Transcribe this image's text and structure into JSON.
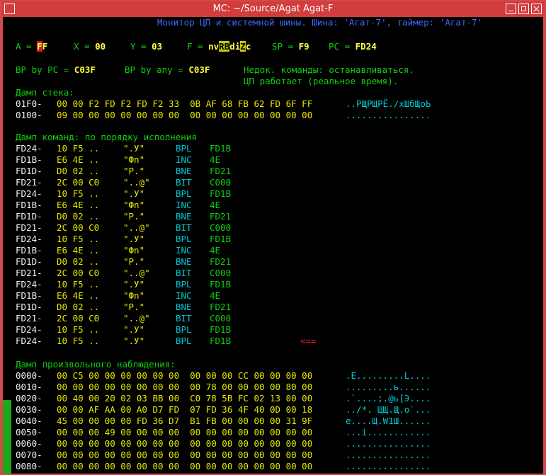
{
  "window": {
    "title": "MC: ~/Source/Agat Agat-F"
  },
  "header": "Монитор ЦП и системной шины. Шина: 'Агат-7', таймер: 'Агат-7'",
  "registers": {
    "a_label": "A = ",
    "a_value": "FF",
    "x_label": "X = ",
    "x_value": "00",
    "y_label": "Y = ",
    "y_value": "03",
    "f_label": "F = ",
    "f_value": "nvRBdiZc",
    "sp_label": "SP = ",
    "sp_value": "F9",
    "pc_label": "PC = ",
    "pc_value": "FD24"
  },
  "breakpoints": {
    "bp_pc_label": "BP by PC = ",
    "bp_pc_value": "C03F",
    "bp_any_label": "BP by any = ",
    "bp_any_value": "C03F",
    "status1": "Недок. команды: останавливаться.",
    "status2": "ЦП работает (реальное время)."
  },
  "stack": {
    "title": "Дамп стека:",
    "rows": [
      {
        "addr": "01F0-",
        "hex": "00 00 F2 FD F2 FD F2 33  0B AF 68 FB 62 FD 6F FF",
        "ascii": "..РЩРЩРЁ./хШбЩоЬ"
      },
      {
        "addr": "0100-",
        "hex": "09 00 00 00 00 00 00 00  00 00 00 00 00 00 00 00",
        "ascii": "................"
      }
    ]
  },
  "disasm": {
    "title": "Дамп команд: по порядку исполнения",
    "arrow": "<==",
    "rows": [
      {
        "addr": "FD24-",
        "bytes": "10 F5 ..",
        "chars": "\".У\"",
        "op": "BPL",
        "arg": "FD1B"
      },
      {
        "addr": "FD1B-",
        "bytes": "E6 4E ..",
        "chars": "\"Фn\"",
        "op": "INC",
        "arg": "4E"
      },
      {
        "addr": "FD1D-",
        "bytes": "D0 02 ..",
        "chars": "\"Р.\"",
        "op": "BNE",
        "arg": "FD21"
      },
      {
        "addr": "FD21-",
        "bytes": "2C 00 C0",
        "chars": "\"..@\"",
        "op": "BIT",
        "arg": "C000"
      },
      {
        "addr": "FD24-",
        "bytes": "10 F5 ..",
        "chars": "\".У\"",
        "op": "BPL",
        "arg": "FD1B"
      },
      {
        "addr": "FD1B-",
        "bytes": "E6 4E ..",
        "chars": "\"Фn\"",
        "op": "INC",
        "arg": "4E"
      },
      {
        "addr": "FD1D-",
        "bytes": "D0 02 ..",
        "chars": "\"Р.\"",
        "op": "BNE",
        "arg": "FD21"
      },
      {
        "addr": "FD21-",
        "bytes": "2C 00 C0",
        "chars": "\"..@\"",
        "op": "BIT",
        "arg": "C000"
      },
      {
        "addr": "FD24-",
        "bytes": "10 F5 ..",
        "chars": "\".У\"",
        "op": "BPL",
        "arg": "FD1B"
      },
      {
        "addr": "FD1B-",
        "bytes": "E6 4E ..",
        "chars": "\"Фn\"",
        "op": "INC",
        "arg": "4E"
      },
      {
        "addr": "FD1D-",
        "bytes": "D0 02 ..",
        "chars": "\"Р.\"",
        "op": "BNE",
        "arg": "FD21"
      },
      {
        "addr": "FD21-",
        "bytes": "2C 00 C0",
        "chars": "\"..@\"",
        "op": "BIT",
        "arg": "C000"
      },
      {
        "addr": "FD24-",
        "bytes": "10 F5 ..",
        "chars": "\".У\"",
        "op": "BPL",
        "arg": "FD1B"
      },
      {
        "addr": "FD1B-",
        "bytes": "E6 4E ..",
        "chars": "\"Фn\"",
        "op": "INC",
        "arg": "4E"
      },
      {
        "addr": "FD1D-",
        "bytes": "D0 02 ..",
        "chars": "\"Р.\"",
        "op": "BNE",
        "arg": "FD21"
      },
      {
        "addr": "FD21-",
        "bytes": "2C 00 C0",
        "chars": "\"..@\"",
        "op": "BIT",
        "arg": "C000"
      },
      {
        "addr": "FD24-",
        "bytes": "10 F5 ..",
        "chars": "\".У\"",
        "op": "BPL",
        "arg": "FD1B"
      },
      {
        "addr": "FD24-",
        "bytes": "10 F5 ..",
        "chars": "\".У\"",
        "op": "BPL",
        "arg": "FD1B"
      }
    ]
  },
  "watch": {
    "title": "Дамп произвольного наблюдения:",
    "rows": [
      {
        "addr": "0000-",
        "hex": "00 C5 00 00 00 00 00 00  00 00 00 CC 00 00 00 00",
        "ascii": ".Е.........L...."
      },
      {
        "addr": "0010-",
        "hex": "00 00 00 00 00 00 00 00  00 78 00 00 00 00 80 00",
        "ascii": ".........ь......"
      },
      {
        "addr": "0020-",
        "hex": "00 40 00 20 02 03 BB 00  C0 78 5B FC 02 13 00 00",
        "ascii": ".`....;.@ь[Э...."
      },
      {
        "addr": "0030-",
        "hex": "00 00 AF AA 00 A0 D7 FD  07 FD 36 4F 40 0D 00 18",
        "ascii": "../*. ЩЩ.Щ.o`..."
      },
      {
        "addr": "0040-",
        "hex": "45 00 00 00 00 FD 36 D7  B1 FB 00 00 00 00 31 9F",
        "ascii": "е....Щ.W1Ш......"
      },
      {
        "addr": "0050-",
        "hex": "00 00 00 49 00 00 00 00  00 00 00 00 00 00 00 00",
        "ascii": "...i............"
      },
      {
        "addr": "0060-",
        "hex": "00 00 00 00 00 00 00 00  00 00 00 00 00 00 00 00",
        "ascii": "................"
      },
      {
        "addr": "0070-",
        "hex": "00 00 00 00 00 00 00 00  00 00 00 00 00 00 00 00",
        "ascii": "................"
      },
      {
        "addr": "0080-",
        "hex": "00 00 00 00 00 00 00 00  00 00 00 00 00 00 00 00",
        "ascii": "................"
      }
    ]
  }
}
